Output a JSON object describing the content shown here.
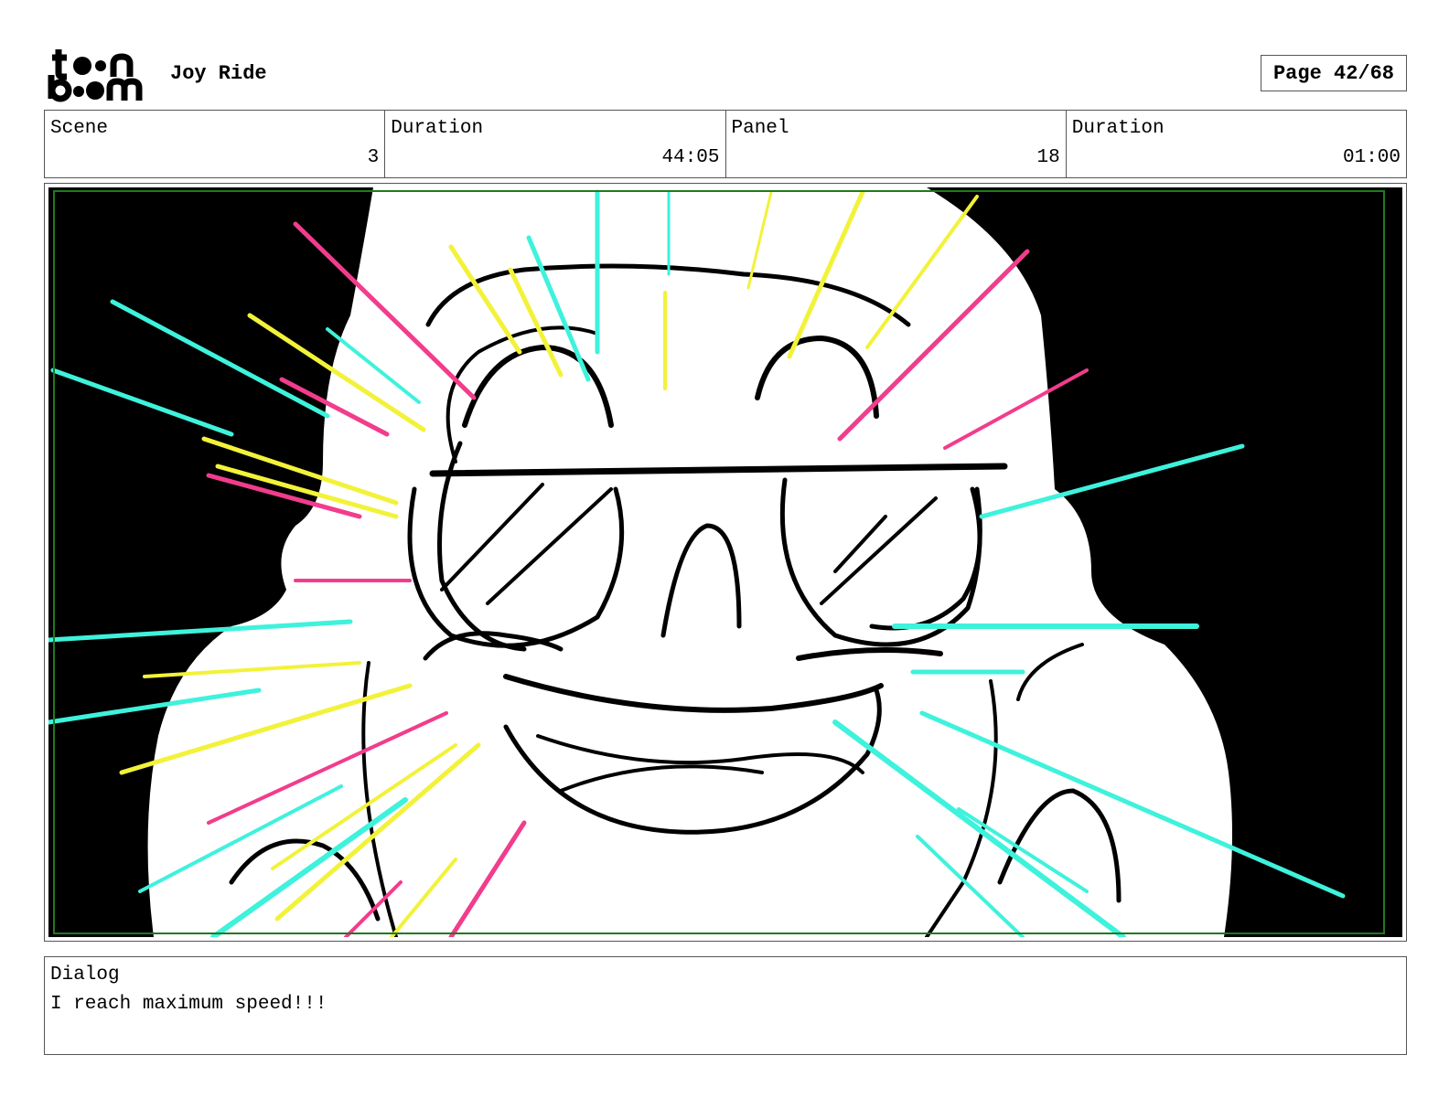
{
  "header": {
    "logo_text": "toon boom",
    "project_title": "Joy Ride",
    "page": "Page 42/68"
  },
  "info": {
    "scene_label": "Scene",
    "scene_value": "3",
    "scene_duration_label": "Duration",
    "scene_duration_value": "44:05",
    "panel_label": "Panel",
    "panel_value": "18",
    "panel_duration_label": "Duration",
    "panel_duration_value": "01:00"
  },
  "dialog": {
    "label": "Dialog",
    "text": "I reach maximum speed!!!"
  },
  "colors": {
    "cyan": "#3ef2dc",
    "yellow": "#f2f23a",
    "pink": "#f23c8c",
    "safe_frame": "#1f7a1f"
  }
}
